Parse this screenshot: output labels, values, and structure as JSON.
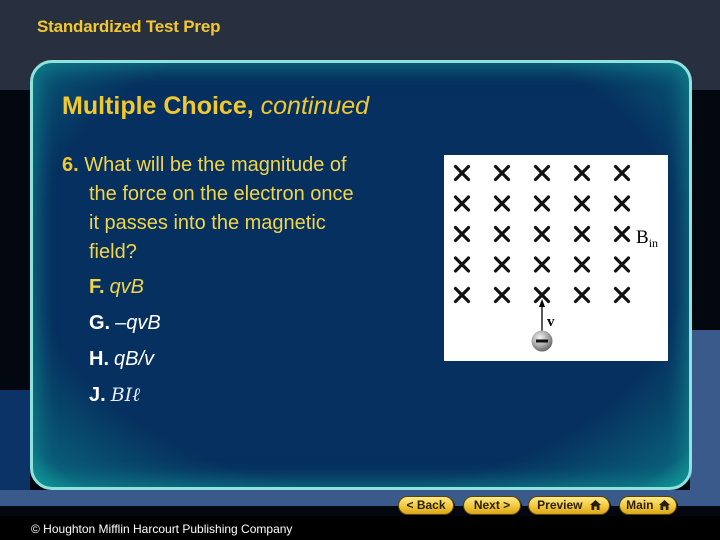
{
  "header": {
    "title": "Standardized Test Prep"
  },
  "panel": {
    "title_bold": "Multiple Choice,",
    "title_italic": "continued"
  },
  "question": {
    "number": "6.",
    "lines": [
      "What will be the magnitude of",
      "the force on the electron once",
      "it passes into the magnetic",
      "field?"
    ],
    "choices": [
      {
        "letter": "F.",
        "answer": "qvB"
      },
      {
        "letter": "G.",
        "answer": "–qvB"
      },
      {
        "letter": "H.",
        "answer": "qB/v"
      },
      {
        "letter": "J.",
        "answer": "BIℓ"
      }
    ]
  },
  "figure": {
    "field_symbol": "×",
    "rows": 5,
    "cols": 5,
    "field_label_main": "B",
    "field_label_sub": "in",
    "velocity_label": "v",
    "charge_sign": "−"
  },
  "nav": {
    "back": "< Back",
    "next": "Next >",
    "preview": "Preview",
    "main": "Main"
  },
  "footer": {
    "copyright": "© Houghton Mifflin Harcourt Publishing Company"
  },
  "colors": {
    "accent_yellow": "#f2c831",
    "panel_blue": "#06305f",
    "panel_border": "#8fe3dc"
  }
}
